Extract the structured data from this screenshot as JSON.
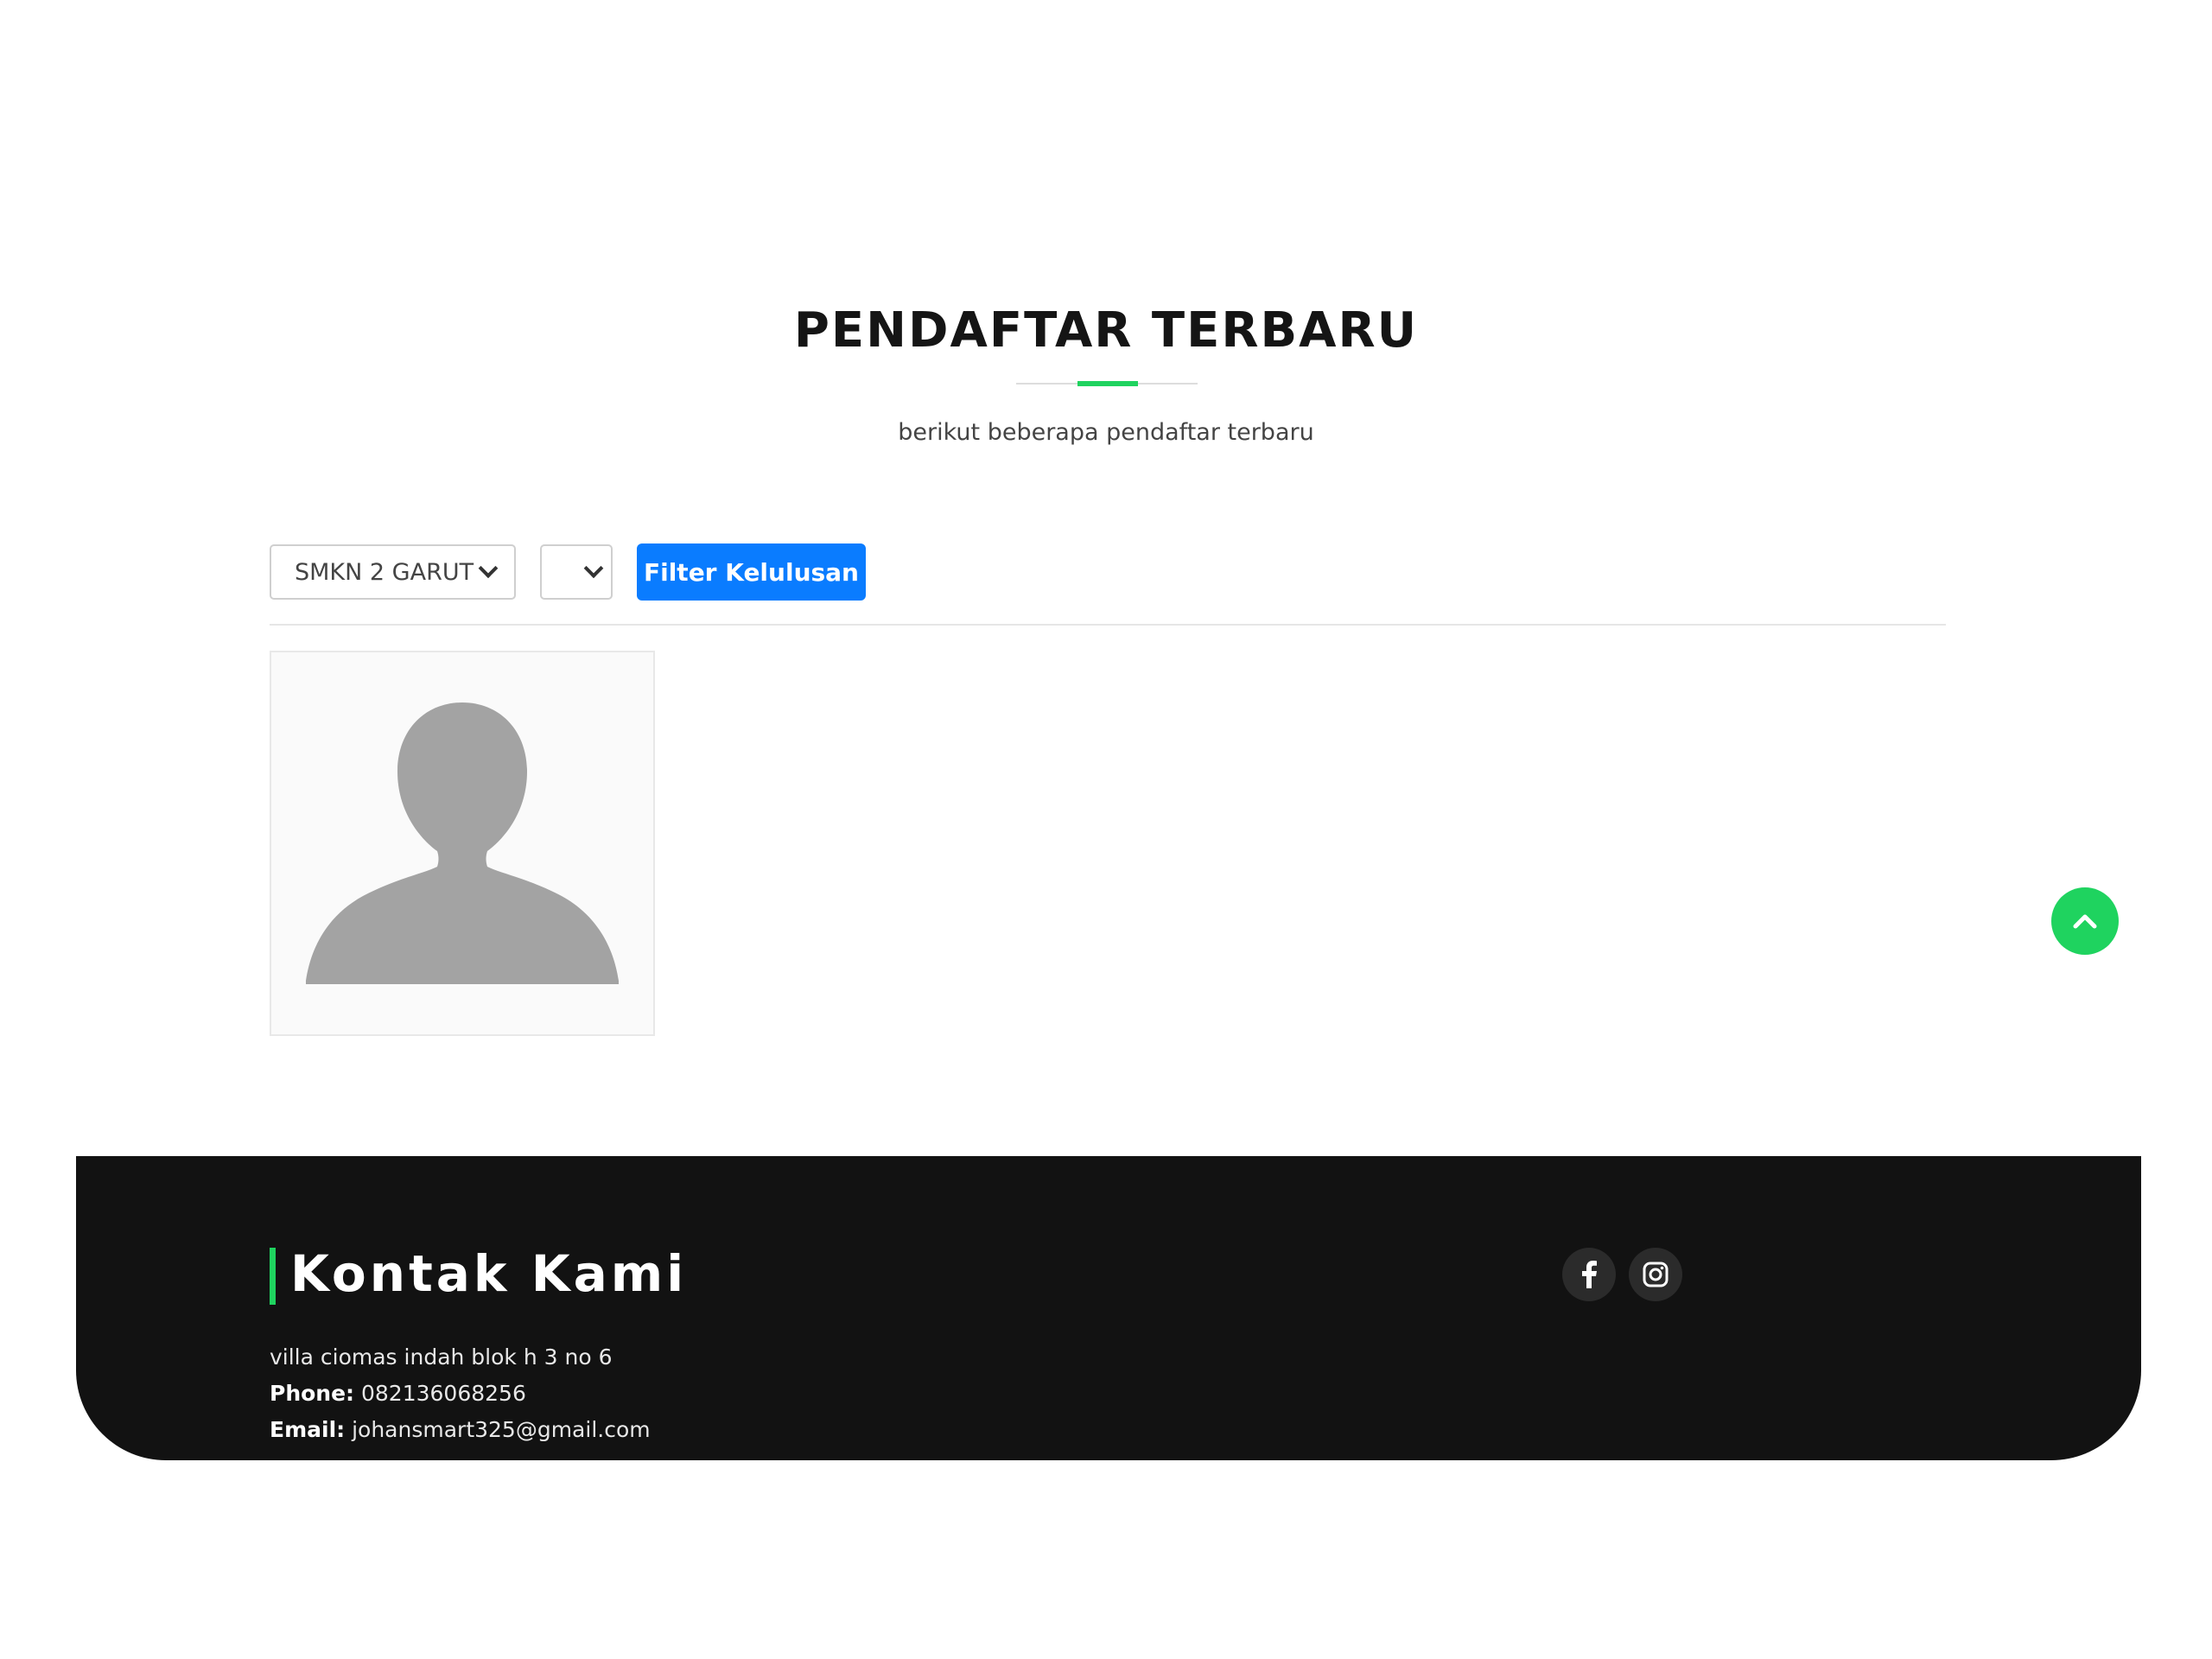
{
  "section": {
    "title": "PENDAFTAR TERBARU",
    "subtitle": "berikut beberapa pendaftar terbaru"
  },
  "filters": {
    "school_selected": "SMKN 2 GARUT",
    "year_selected": "",
    "button_label": "Filter Kelulusan"
  },
  "registrants": [
    {
      "photo": "default-avatar-icon"
    }
  ],
  "footer": {
    "heading": "Kontak Kami",
    "address": "villa ciomas indah blok h 3 no 6",
    "phone_label": "Phone:",
    "phone": "082136068256",
    "email_label": "Email:",
    "email": "johansmart325@gmail.com",
    "social": [
      "facebook-icon",
      "instagram-icon"
    ]
  },
  "colors": {
    "accent_green": "#1fd35f",
    "button_blue": "#0a7cff",
    "footer_bg": "#121212"
  }
}
